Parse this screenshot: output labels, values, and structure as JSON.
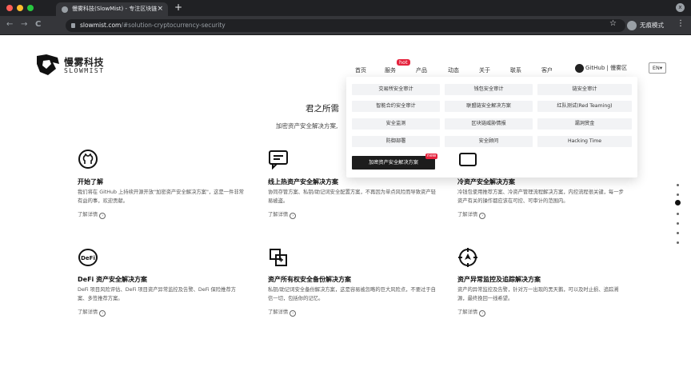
{
  "browser": {
    "tab_title": "慢雾科技(SlowMist) - 专注区块链",
    "tab_close": "×",
    "new_tab": "+",
    "back": "←",
    "forward": "→",
    "reload": "C",
    "url_host": "slowmist.com",
    "url_path": "/#solution-cryptocurrency-security",
    "bookmark": "☆",
    "incognito_label": "无痕模式",
    "menu": "⋮",
    "window_control": "x"
  },
  "site": {
    "brand_cn": "慢雾科技",
    "brand_en": "SLOWMIST",
    "nav": [
      {
        "label": "首页"
      },
      {
        "label": "服务"
      },
      {
        "label": "产品"
      },
      {
        "label": "动态"
      },
      {
        "label": "关于"
      },
      {
        "label": "联系"
      },
      {
        "label": "客户"
      }
    ],
    "hot_badge": "hot",
    "github_label": "GitHub | 慢雾区",
    "lang_label": "EN▾"
  },
  "hero": {
    "title": "君之所需",
    "subtitle": "加密资产安全解决方案,"
  },
  "mega_menu": {
    "cells": [
      {
        "label": "交易所安全审计"
      },
      {
        "label": "钱包安全审计"
      },
      {
        "label": "链安全审计"
      },
      {
        "label": "智能合约安全审计"
      },
      {
        "label": "联盟链安全解决方案"
      },
      {
        "label": "红队测试(Red Teaming)"
      },
      {
        "label": "安全监测"
      },
      {
        "label": "区块链威胁情报"
      },
      {
        "label": "漏洞赏金"
      },
      {
        "label": "防御部署"
      },
      {
        "label": "安全顾问"
      },
      {
        "label": "Hacking Time"
      }
    ],
    "featured": "加密资产安全解决方案",
    "new_badge": "new"
  },
  "cards": [
    {
      "title": "开始了解",
      "desc": "我们将在 GitHub 上持续开源开放\"加密资产安全解决方案\"，这是一件非常有益的事，欢迎贡献。",
      "more": "了解详情"
    },
    {
      "title": "线上热资产安全解决方案",
      "desc": "协同存管方案、私钥/助记词安全配置方案，不再因为单点风险而导致资产轻易被盗。",
      "more": "了解详情"
    },
    {
      "title": "冷资产安全解决方案",
      "desc": "冷钱包使用推荐方案、冷资产管理流程解决方案，内控流程很关键，每一步资产有关的操作都应该在可控、可审计的范围内。",
      "more": "了解详情"
    },
    {
      "title": "DeFi 资产安全解决方案",
      "desc": "DeFi 项目风险评估、DeFi 项目资产异常监控及告警、DeFi 保险推荐方案、多签推荐方案。",
      "more": "了解详情"
    },
    {
      "title": "资产所有权安全备份解决方案",
      "desc": "私钥/助记词安全备份解决方案，这是容易被忽略的巨大风险点，不要过于自信一切，包括你的记忆。",
      "more": "了解详情"
    },
    {
      "title": "资产异常监控及追踪解决方案",
      "desc": "资产的异常监控及告警，针对万一出现的黑天鹅，可以及时止损、追踪溯源，最终挽回一线希望。",
      "more": "了解详情"
    }
  ],
  "card_icons": [
    "github-icon",
    "chat-icon",
    "wallet-icon",
    "defi-icon",
    "backup-icon",
    "target-icon"
  ],
  "colors": {
    "accent": "#e5233d",
    "browser_dark": "#202124",
    "text": "#222222"
  }
}
